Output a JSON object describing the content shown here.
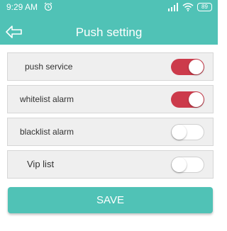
{
  "status_bar": {
    "time": "9:29 AM",
    "battery": "89"
  },
  "header": {
    "title": "Push setting"
  },
  "settings": [
    {
      "label": "push service",
      "state": "on"
    },
    {
      "label": "whitelist alarm",
      "state": "on"
    },
    {
      "label": "blacklist alarm",
      "state": "off"
    },
    {
      "label": "Vip list",
      "state": "off"
    }
  ],
  "save_label": "SAVE",
  "colors": {
    "accent": "#50c2b6",
    "toggle_on": "#cc3b4b"
  }
}
